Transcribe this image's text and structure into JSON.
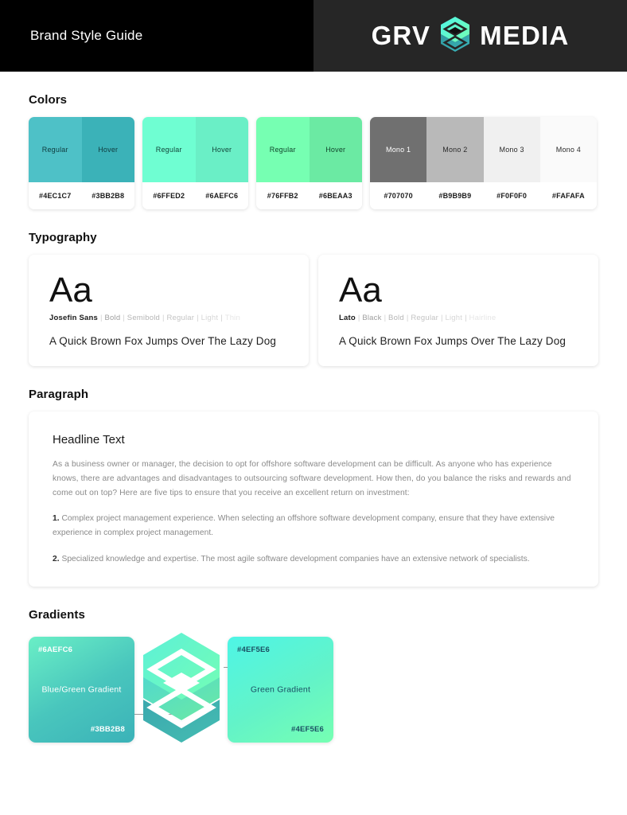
{
  "header": {
    "title": "Brand Style Guide",
    "logo_left_text": "GRV",
    "logo_right_text": "MEDIA",
    "logo_icon": "grv-hexagon-logo"
  },
  "sections": {
    "colors_title": "Colors",
    "typography_title": "Typography",
    "paragraph_title": "Paragraph",
    "gradients_title": "Gradients"
  },
  "colors": {
    "cards": [
      {
        "swatches": [
          {
            "label": "Regular",
            "hex": "#4EC1C7",
            "text_color": "#0f3b3e"
          },
          {
            "label": "Hover",
            "hex": "#3BB2B8",
            "text_color": "#0f3b3e"
          }
        ]
      },
      {
        "swatches": [
          {
            "label": "Regular",
            "hex": "#6FFED2",
            "text_color": "#12463a"
          },
          {
            "label": "Hover",
            "hex": "#6AEFC6",
            "text_color": "#12463a"
          }
        ]
      },
      {
        "swatches": [
          {
            "label": "Regular",
            "hex": "#76FFB2",
            "text_color": "#11462c"
          },
          {
            "label": "Hover",
            "hex": "#6BEAA3",
            "text_color": "#11462c"
          }
        ]
      },
      {
        "swatches": [
          {
            "label": "Mono 1",
            "hex": "#707070",
            "text_color": "#ffffff"
          },
          {
            "label": "Mono 2",
            "hex": "#B9B9B9",
            "text_color": "#2b2b2b"
          },
          {
            "label": "Mono 3",
            "hex": "#F0F0F0",
            "text_color": "#2b2b2b"
          },
          {
            "label": "Mono 4",
            "hex": "#FAFAFA",
            "text_color": "#2b2b2b"
          }
        ]
      }
    ]
  },
  "typography": {
    "cards": [
      {
        "aa": "Aa",
        "family": "Josefin Sans",
        "weights": [
          "Bold",
          "Semibold",
          "Regular",
          "Light",
          "Thin"
        ],
        "sample": "A Quick Brown Fox Jumps Over The Lazy Dog"
      },
      {
        "aa": "Aa",
        "family": "Lato",
        "weights": [
          "Black",
          "Bold",
          "Regular",
          "Light",
          "Hairline"
        ],
        "sample": "A Quick Brown Fox Jumps Over The Lazy Dog"
      }
    ]
  },
  "paragraph": {
    "headline": "Headline Text",
    "intro": "As a business owner or manager, the decision to opt for offshore software development can be difficult. As anyone who has experience knows, there are advantages and disadvantages to outsourcing software development. How then, do you balance the risks and rewards and come out on top? Here are five tips to ensure that you receive an excellent return on investment:",
    "items": [
      {
        "number": "1.",
        "text": "Complex project management experience. When selecting an offshore software development company, ensure that they have extensive experience in complex project management."
      },
      {
        "number": "2.",
        "text": "Specialized knowledge and expertise. The most agile software development companies have an extensive network of specialists."
      }
    ]
  },
  "gradients": {
    "blue_green": {
      "name": "Blue/Green Gradient",
      "top_hex": "#6AEFC6",
      "bottom_hex": "#3BB2B8"
    },
    "green": {
      "name": "Green Gradient",
      "top_hex": "#4EF5E6",
      "bottom_hex": "#4EF5E6"
    },
    "logo_icon": "grv-hexagon-logo"
  }
}
